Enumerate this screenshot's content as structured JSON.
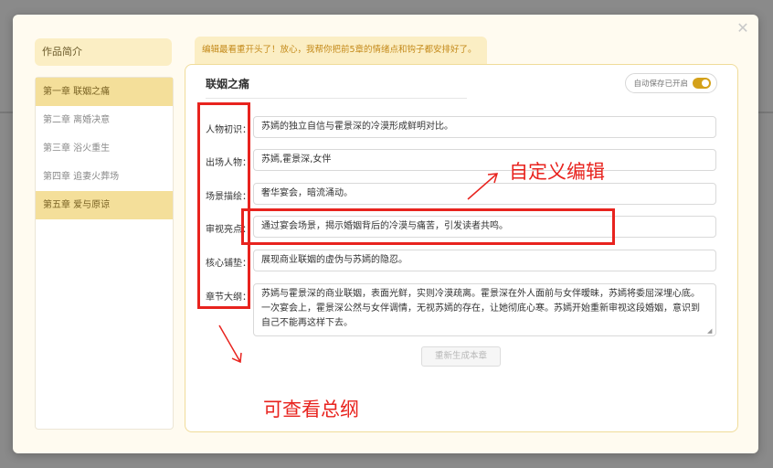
{
  "sidebar": {
    "title": "作品简介",
    "chapters": [
      {
        "label": "第一章 联姻之痛"
      },
      {
        "label": "第二章 离婚决意"
      },
      {
        "label": "第三章 浴火重生"
      },
      {
        "label": "第四章 追妻火葬场"
      },
      {
        "label": "第五章 爱与原谅"
      }
    ]
  },
  "tip": "编辑最看重开头了！放心，我帮你把前5章的情绪点和钩子都安排好了。",
  "panel": {
    "chapter_title": "联姻之痛",
    "autosave_label": "自动保存已开启",
    "regen_label": "重新生成本章",
    "fields": [
      {
        "label": "人物初识：",
        "value": "苏嫣的独立自信与霍景深的冷漠形成鲜明对比。"
      },
      {
        "label": "出场人物：",
        "value": "苏嫣,霍景深,女伴"
      },
      {
        "label": "场景描绘：",
        "value": "奢华宴会，暗流涌动。"
      },
      {
        "label": "审视亮点：",
        "value": "通过宴会场景，揭示婚姻背后的冷漠与痛苦，引发读者共鸣。"
      },
      {
        "label": "核心铺垫：",
        "value": "展现商业联姻的虚伪与苏嫣的隐忍。"
      },
      {
        "label": "章节大纲：",
        "value": "苏嫣与霍景深的商业联姻，表面光鲜，实则冷漠疏离。霍景深在外人面前与女伴暧昧，苏嫣将委屈深埋心底。一次宴会上，霍景深公然与女伴调情，无视苏嫣的存在，让她彻底心寒。苏嫣开始重新审视这段婚姻，意识到自己不能再这样下去。"
      }
    ]
  },
  "annotations": {
    "custom_edit": "自定义编辑",
    "view_outline": "可查看总纲",
    "color": "#e8231e"
  },
  "colors": {
    "accent": "#d4a11a",
    "active_item": "#f4df9a",
    "tip_bg": "#fbeec4",
    "tip_text": "#c48a1a"
  }
}
